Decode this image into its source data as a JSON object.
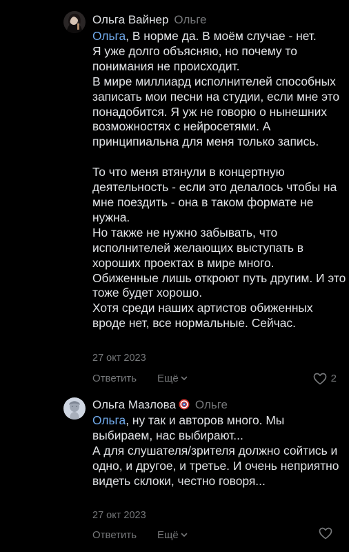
{
  "comments": [
    {
      "author": "Ольга Вайнер",
      "reply_to": "Ольге",
      "mention": "Ольга",
      "text": ", В норме да. В моём случае - нет.\nЯ уже долго объясняю, но почему то понимания не происходит.\nВ мире миллиард исполнителей способных записать мои песни на студии, если мне это понадобится. Я уж не говорю о нынешних возможностях с нейросетями. А принципиальна для меня только запись.\n\nТо что меня втянули в концертную деятельность - если это делалось чтобы на мне поездить - она в таком формате не нужна.\nНо также не нужно забывать, что исполнителей желающих выступать в хороших проектах в мире много.\nОбиженные лишь откроют путь другим. И это тоже будет хорошо.\nХотя среди наших артистов обиженных вроде нет, все нормальные. Сейчас.",
      "date": "27 окт 2023",
      "reply_label": "Ответить",
      "more_label": "Ещё",
      "likes": "2"
    },
    {
      "author": "Ольга Мазлова",
      "reply_to": "Ольге",
      "mention": "Ольга",
      "text": ", ну так и авторов много. Мы выбираем, нас выбирают...\nА для слушателя/зрителя должно сойтись и одно, и другое, и третье. И очень неприятно видеть склоки, честно говоря...",
      "date": "27 окт 2023",
      "reply_label": "Ответить",
      "more_label": "Ещё",
      "likes": ""
    }
  ],
  "colors": {
    "background": "#000000",
    "text": "#e1e3e6",
    "secondary": "#76787a",
    "link": "#71aaeb"
  },
  "icons": {
    "badge": "captain-america-shield-icon",
    "more": "chevron-down-icon",
    "like": "heart-icon"
  }
}
